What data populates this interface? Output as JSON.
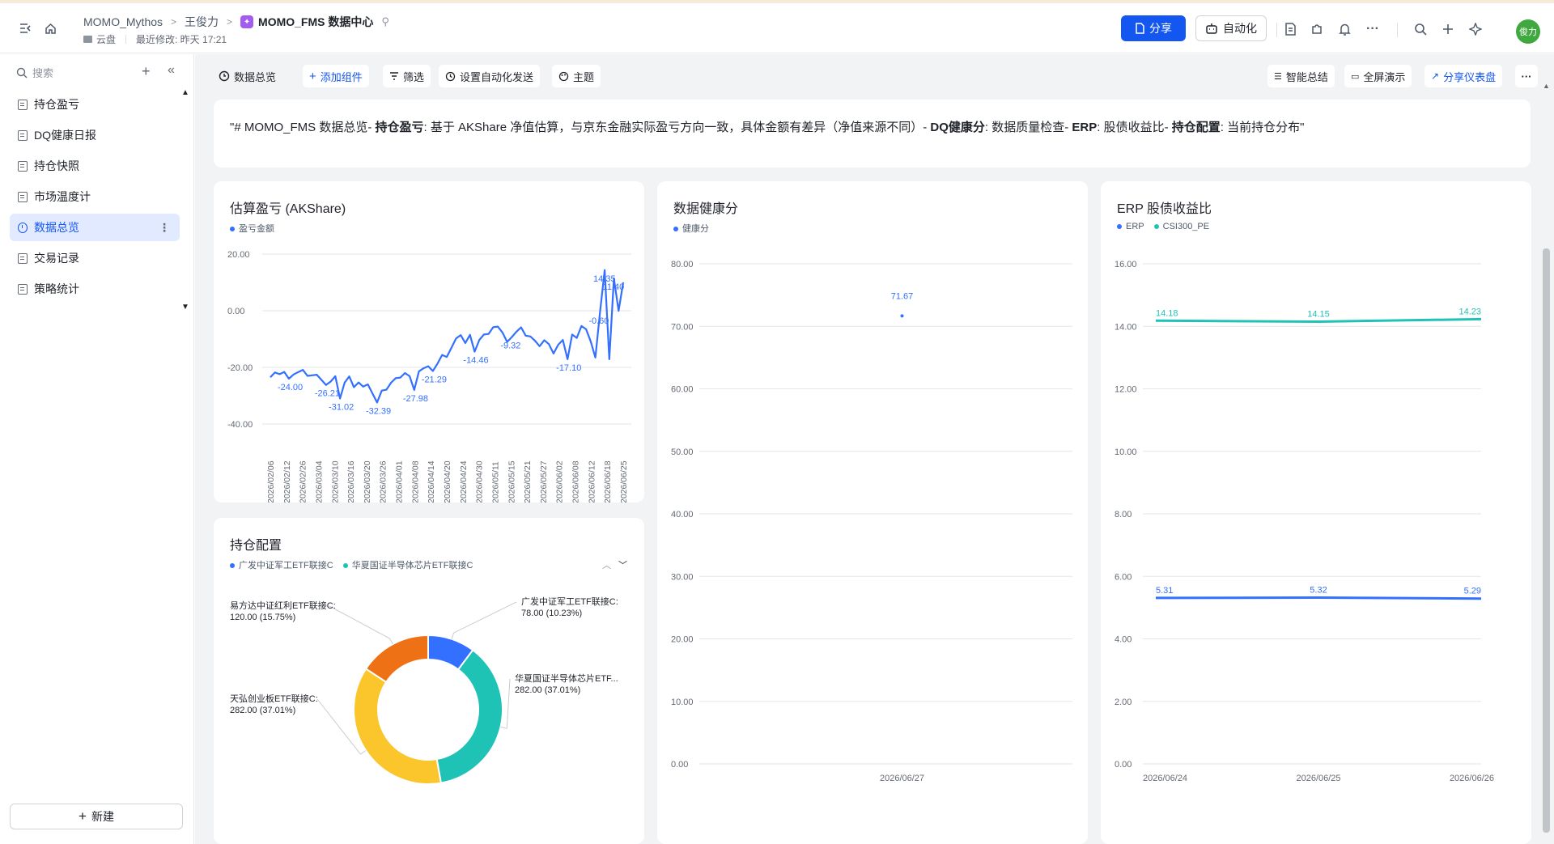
{
  "header": {
    "breadcrumb": [
      "MOMO_Mythos",
      "王俊力",
      "MOMO_FMS 数据中心"
    ],
    "location": "云盘",
    "last_modified": "最近修改: 昨天 17:21",
    "share_label": "分享",
    "automation_label": "自动化",
    "avatar_text": "俊力"
  },
  "sidebar": {
    "search_placeholder": "搜索",
    "items": [
      {
        "label": "持仓盈亏",
        "active": false
      },
      {
        "label": "DQ健康日报",
        "active": false
      },
      {
        "label": "持仓快照",
        "active": false
      },
      {
        "label": "市场温度计",
        "active": false
      },
      {
        "label": "数据总览",
        "active": true
      },
      {
        "label": "交易记录",
        "active": false
      },
      {
        "label": "策略统计",
        "active": false
      }
    ],
    "new_label": "新建"
  },
  "toolbar": {
    "title": "数据总览",
    "add_widget": "添加组件",
    "filter": "筛选",
    "auto_send": "设置自动化发送",
    "theme": "主题",
    "smart_summary": "智能总结",
    "fullscreen": "全屏演示",
    "share_dashboard": "分享仪表盘"
  },
  "textcard": {
    "p1": "\"# MOMO_FMS 数据总览- ",
    "b1": "持仓盈亏",
    "p2": ": 基于 AKShare 净值估算，与京东金融实际盈亏方向一致，具体金额有差异（净值来源不同）- ",
    "b2": "DQ健康分",
    "p3": ": 数据质量检查- ",
    "b3": "ERP",
    "p4": ": 股债收益比- ",
    "b4": "持仓配置",
    "p5": ": 当前持仓分布\""
  },
  "colors": {
    "blue": "#3370ff",
    "teal": "#1fc3b5",
    "yellow": "#fbc62b",
    "orange": "#ef7116",
    "accent": "#1456f0"
  },
  "chart_data": [
    {
      "type": "line",
      "title": "估算盈亏 (AKShare)",
      "series": [
        {
          "name": "盈亏金额"
        }
      ],
      "y_ticks": [
        "20.00",
        "0.00",
        "-20.00",
        "-40.00"
      ],
      "ylim": [
        -40,
        20
      ],
      "x_ticks": [
        "2026/02/06",
        "2026/02/12",
        "2026/02/26",
        "2026/03/04",
        "2026/03/10",
        "2026/03/16",
        "2026/03/20",
        "2026/03/26",
        "2026/04/01",
        "2026/04/08",
        "2026/04/14",
        "2026/04/20",
        "2026/04/24",
        "2026/04/30",
        "2026/05/11",
        "2026/05/15",
        "2026/05/21",
        "2026/05/27",
        "2026/06/02",
        "2026/06/08",
        "2026/06/12",
        "2026/06/18",
        "2026/06/25"
      ],
      "values": [
        -23.5,
        -21.8,
        -22.4,
        -21.6,
        -24.0,
        -22.5,
        -21.7,
        -20.9,
        -23.0,
        -22.8,
        -22.6,
        -24.4,
        -26.2,
        -25.0,
        -23.1,
        -31.0,
        -25.4,
        -23.2,
        -27.0,
        -25.3,
        -26.8,
        -26.0,
        -29.2,
        -32.4,
        -28.2,
        -27.9,
        -25.4,
        -23.8,
        -23.6,
        -22.0,
        -23.1,
        -27.98,
        -21.4,
        -20.3,
        -19.6,
        -21.29,
        -18.7,
        -15.6,
        -16.3,
        -13.1,
        -9.8,
        -8.6,
        -11.4,
        -8.5,
        -14.46,
        -10.3,
        -8.4,
        -8.2,
        -5.8,
        -5.6,
        -7.7,
        -11.0,
        -9.32,
        -7.4,
        -5.87,
        -8.8,
        -9.1,
        -10.6,
        -12.5,
        -10.4,
        -11.8,
        -15.1,
        -12.0,
        -10.3,
        -17.1,
        -8.4,
        -9.6,
        -5.4,
        -6.5,
        -10.8,
        -16.5,
        -0.6,
        14.35,
        -17.1,
        11.4,
        -0.03,
        10.0
      ],
      "data_labels": [
        "-24.00",
        "-26.21",
        "-31.02",
        "-32.39",
        "-27.98",
        "-21.29",
        "-14.46",
        "-9.32",
        "-17.10",
        "14.35",
        "11.40",
        "-0.60"
      ]
    },
    {
      "type": "line",
      "title": "数据健康分",
      "series": [
        {
          "name": "健康分",
          "values": [
            71.67
          ]
        }
      ],
      "categories": [
        "2026/06/27"
      ],
      "y_ticks": [
        "80.00",
        "70.00",
        "60.00",
        "50.00",
        "40.00",
        "30.00",
        "20.00",
        "10.00",
        "0.00"
      ],
      "ylim": [
        0,
        80
      ],
      "data_labels": [
        "71.67"
      ]
    },
    {
      "type": "line",
      "title": "ERP 股债收益比",
      "categories": [
        "2026/06/24",
        "2026/06/25",
        "2026/06/26"
      ],
      "series": [
        {
          "name": "ERP",
          "values": [
            5.31,
            5.32,
            5.29
          ]
        },
        {
          "name": "CSI300_PE",
          "values": [
            14.18,
            14.15,
            14.23
          ]
        }
      ],
      "y_ticks": [
        "16.00",
        "14.00",
        "12.00",
        "10.00",
        "8.00",
        "6.00",
        "4.00",
        "2.00",
        "0.00"
      ],
      "ylim": [
        0,
        16
      ]
    },
    {
      "type": "pie",
      "title": "持仓配置",
      "legend": [
        "广发中证军工ETF联接C",
        "华夏国证半导体芯片ETF联接C"
      ],
      "slices": [
        {
          "name": "广发中证军工ETF联接C",
          "value": 78.0,
          "pct": "10.23%",
          "label_name": "广发中证军工ETF联接C:",
          "label_val": "78.00 (10.23%)"
        },
        {
          "name": "华夏国证半导体芯片ETF联接C",
          "value": 282.0,
          "pct": "37.01%",
          "label_name": "华夏国证半导体芯片ETF...",
          "label_val": "282.00 (37.01%)"
        },
        {
          "name": "天弘创业板ETF联接C",
          "value": 282.0,
          "pct": "37.01%",
          "label_name": "天弘创业板ETF联接C:",
          "label_val": "282.00 (37.01%)"
        },
        {
          "name": "易方达中证红利ETF联接C",
          "value": 120.0,
          "pct": "15.75%",
          "label_name": "易方达中证红利ETF联接C:",
          "label_val": "120.00 (15.75%)"
        }
      ]
    }
  ]
}
